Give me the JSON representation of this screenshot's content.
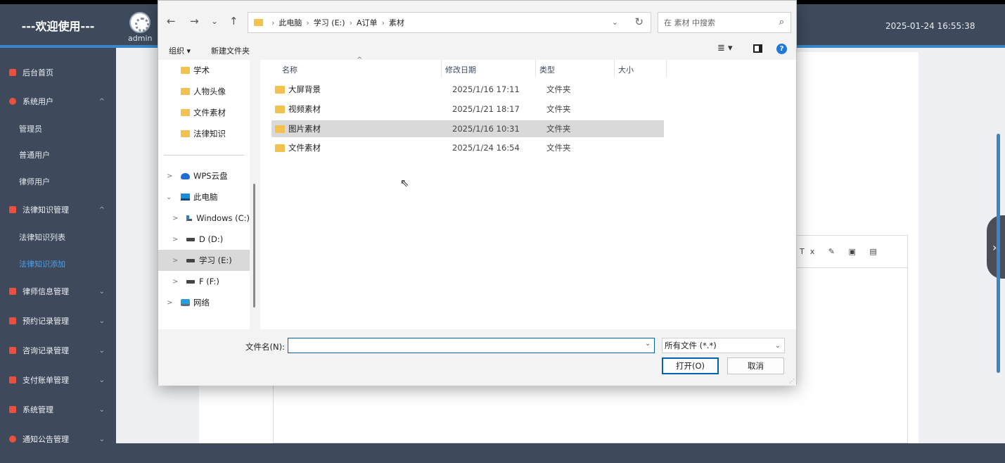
{
  "app": {
    "brand": "---欢迎使用---",
    "admin_name": "admin",
    "datetime": "2025-01-24 16:55:38"
  },
  "sidebar": {
    "items": [
      {
        "label": "后台首页",
        "icon": "monitor-icon"
      },
      {
        "label": "系统用户",
        "icon": "user-icon",
        "chevron": "^"
      },
      {
        "label": "管理员"
      },
      {
        "label": "普通用户"
      },
      {
        "label": "律师用户"
      },
      {
        "label": "法律知识管理",
        "icon": "chart-icon",
        "chevron": "^"
      },
      {
        "label": "法律知识列表"
      },
      {
        "label": "法律知识添加",
        "active": true
      },
      {
        "label": "律师信息管理",
        "icon": "chart-icon",
        "chevron": "⌄"
      },
      {
        "label": "预约记录管理",
        "icon": "chart-icon",
        "chevron": "⌄"
      },
      {
        "label": "咨询记录管理",
        "icon": "chart-icon",
        "chevron": "⌄"
      },
      {
        "label": "支付账单管理",
        "icon": "chart-icon",
        "chevron": "⌄"
      },
      {
        "label": "系统管理",
        "icon": "bar-chart-icon",
        "chevron": "⌄"
      },
      {
        "label": "通知公告管理",
        "icon": "alert-icon",
        "chevron": "⌄"
      }
    ]
  },
  "editor": {
    "tools": "Tx ✎ ▣ ▤"
  },
  "dialog": {
    "nav": {
      "back": "←",
      "forward": "→",
      "recent": "⌄",
      "up": "↑"
    },
    "breadcrumb": [
      "此电脑",
      "学习 (E:)",
      "A订单",
      "素材"
    ],
    "breadcrumb_sep": "›",
    "search_placeholder": "在 素材 中搜索",
    "toolbar": {
      "organize": "组织 ▾",
      "new_folder": "新建文件夹",
      "view": "≣ ▾",
      "help": "?"
    },
    "nav_pane": [
      {
        "label": "学术",
        "icon": "folder-icon"
      },
      {
        "label": "人物头像",
        "icon": "folder-icon"
      },
      {
        "label": "文件素材",
        "icon": "folder-icon"
      },
      {
        "label": "法律知识",
        "icon": "folder-icon"
      },
      {
        "label": "WPS云盘",
        "icon": "cloud-icon",
        "arrow": ">"
      },
      {
        "label": "此电脑",
        "icon": "computer-icon",
        "arrow": "⌄"
      },
      {
        "label": "Windows (C:)",
        "icon": "windows-drive-icon",
        "arrow": ">"
      },
      {
        "label": "D (D:)",
        "icon": "drive-icon",
        "arrow": ">"
      },
      {
        "label": "学习 (E:)",
        "icon": "drive-icon",
        "arrow": ">",
        "selected": true
      },
      {
        "label": "F (F:)",
        "icon": "drive-icon",
        "arrow": ">"
      },
      {
        "label": "网络",
        "icon": "network-icon",
        "arrow": ">"
      }
    ],
    "columns": [
      "名称",
      "修改日期",
      "类型",
      "大小"
    ],
    "files": [
      {
        "name": "大屏背景",
        "date": "2025/1/16 17:11",
        "type": "文件夹",
        "size": ""
      },
      {
        "name": "视频素材",
        "date": "2025/1/21 18:17",
        "type": "文件夹",
        "size": ""
      },
      {
        "name": "图片素材",
        "date": "2025/1/16 10:31",
        "type": "文件夹",
        "size": "",
        "selected": true
      },
      {
        "name": "文件素材",
        "date": "2025/1/24 16:54",
        "type": "文件夹",
        "size": ""
      }
    ],
    "footer": {
      "filename_label": "文件名(N):",
      "filename_value": "",
      "filetype": "所有文件 (*.*)",
      "open": "打开(O)",
      "cancel": "取消"
    }
  }
}
